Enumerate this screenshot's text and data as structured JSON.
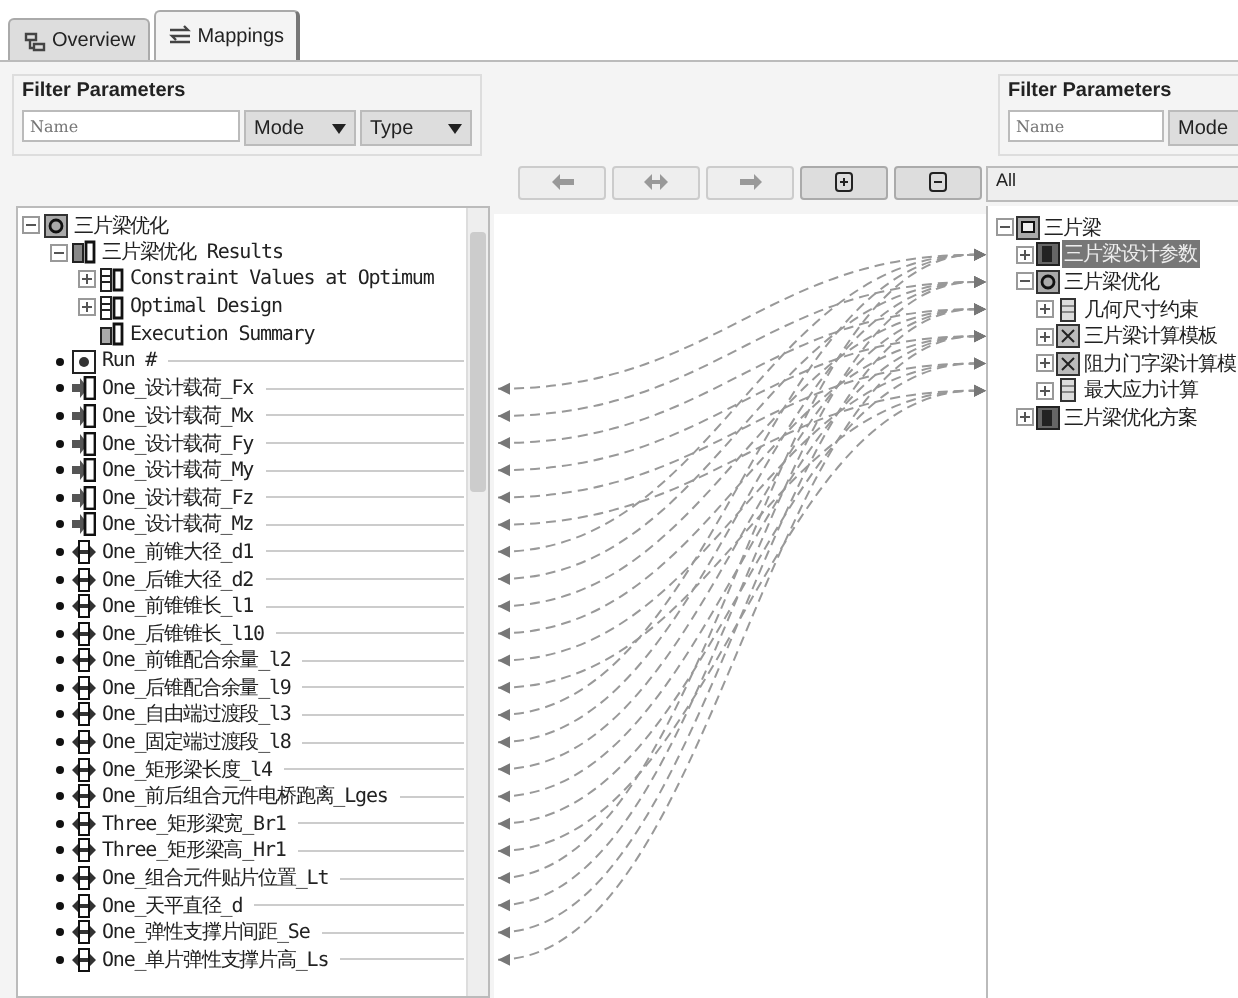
{
  "tabs": [
    {
      "label": "Overview",
      "selected": false
    },
    {
      "label": "Mappings",
      "selected": true
    }
  ],
  "left_filter": {
    "title": "Filter Parameters",
    "placeholder": "Name",
    "mode": "Mode",
    "type": "Type"
  },
  "right_filter": {
    "title": "Filter Parameters",
    "placeholder": "Name",
    "mode": "Mode"
  },
  "toolbar": [
    {
      "kind": "left",
      "disabled": true
    },
    {
      "kind": "both",
      "disabled": true
    },
    {
      "kind": "right",
      "disabled": true
    },
    {
      "kind": "add",
      "disabled": false
    },
    {
      "kind": "remove",
      "disabled": false
    }
  ],
  "right_scope": "All",
  "left_tree": [
    {
      "label": "三片梁优化",
      "kind": "model",
      "expanded": true,
      "children": [
        {
          "label": "三片梁优化 Results",
          "kind": "results",
          "expanded": true,
          "children": [
            {
              "label": "Constraint Values at Optimum",
              "kind": "table",
              "expanded": false
            },
            {
              "label": "Optimal Design",
              "kind": "table",
              "expanded": false
            },
            {
              "label": "Execution Summary",
              "kind": "summary"
            }
          ]
        },
        {
          "label": "Run #",
          "kind": "run"
        },
        {
          "label": "One_设计载荷_Fx",
          "kind": "input"
        },
        {
          "label": "One_设计载荷_Mx",
          "kind": "input"
        },
        {
          "label": "One_设计载荷_Fy",
          "kind": "input"
        },
        {
          "label": "One_设计载荷_My",
          "kind": "input"
        },
        {
          "label": "One_设计载荷_Fz",
          "kind": "input"
        },
        {
          "label": "One_设计载荷_Mz",
          "kind": "input"
        },
        {
          "label": "One_前锥大径_d1",
          "kind": "variable"
        },
        {
          "label": "One_后锥大径_d2",
          "kind": "variable"
        },
        {
          "label": "One_前锥锥长_l1",
          "kind": "variable"
        },
        {
          "label": "One_后锥锥长_l10",
          "kind": "variable"
        },
        {
          "label": "One_前锥配合余量_l2",
          "kind": "variable"
        },
        {
          "label": "One_后锥配合余量_l9",
          "kind": "variable"
        },
        {
          "label": "One_自由端过渡段_l3",
          "kind": "variable"
        },
        {
          "label": "One_固定端过渡段_l8",
          "kind": "variable"
        },
        {
          "label": "One_矩形梁长度_l4",
          "kind": "variable"
        },
        {
          "label": "One_前后组合元件电桥跑离_Lges",
          "kind": "variable"
        },
        {
          "label": "Three_矩形梁宽_Br1",
          "kind": "variable"
        },
        {
          "label": "Three_矩形梁高_Hr1",
          "kind": "variable"
        },
        {
          "label": "One_组合元件贴片位置_Lt",
          "kind": "variable"
        },
        {
          "label": "One_天平直径_d",
          "kind": "variable"
        },
        {
          "label": "One_弹性支撑片间距_Se",
          "kind": "variable"
        },
        {
          "label": "One_单片弹性支撑片高_Ls",
          "kind": "variable"
        }
      ]
    }
  ],
  "right_tree": [
    {
      "label": "三片梁",
      "kind": "project",
      "expanded": true,
      "selected": false,
      "children": [
        {
          "label": "三片梁设计参数",
          "kind": "params",
          "expanded": false,
          "selected": true
        },
        {
          "label": "三片梁优化",
          "kind": "model",
          "expanded": true,
          "selected": false,
          "children": [
            {
              "label": "几何尺寸约束",
              "kind": "sheet",
              "expanded": false,
              "selected": false
            },
            {
              "label": "三片梁计算模板",
              "kind": "calc",
              "expanded": false,
              "selected": false
            },
            {
              "label": "阻力门字梁计算模",
              "kind": "calc",
              "expanded": false,
              "selected": false
            },
            {
              "label": "最大应力计算",
              "kind": "sheet",
              "expanded": false,
              "selected": false
            }
          ]
        },
        {
          "label": "三片梁优化方案",
          "kind": "params",
          "expanded": false,
          "selected": false
        }
      ]
    }
  ]
}
